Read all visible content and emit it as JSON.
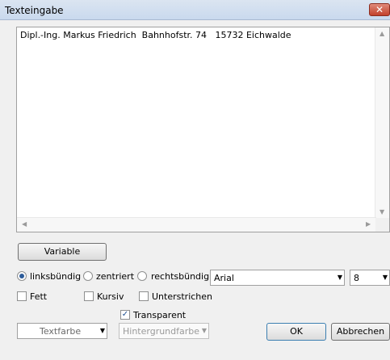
{
  "window": {
    "title": "Texteingabe",
    "close_glyph": "✕"
  },
  "memo": {
    "text": "Dipl.-Ing. Markus Friedrich  Bahnhofstr. 74   15732 Eichwalde"
  },
  "buttons": {
    "variable": "Variable",
    "ok": "OK",
    "cancel": "Abbrechen"
  },
  "alignment": {
    "left": "linksbündig",
    "center": "zentriert",
    "right": "rechtsbündig",
    "selected": "left"
  },
  "font": {
    "name": "Arial",
    "size": "8"
  },
  "style": {
    "bold": "Fett",
    "italic": "Kursiv",
    "underline": "Unterstrichen",
    "transparent": "Transparent",
    "transparent_checked": "true"
  },
  "colors": {
    "text_color": "Textfarbe",
    "background_color": "Hintergrundfarbe"
  }
}
